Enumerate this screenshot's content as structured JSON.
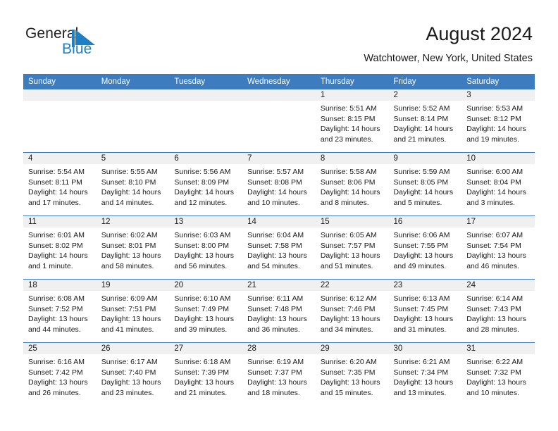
{
  "brand": {
    "name_part1": "General",
    "name_part2": "Blue",
    "flag_color": "#1f7fc4"
  },
  "header": {
    "title": "August 2024",
    "subtitle": "Watchtower, New York, United States"
  },
  "theme": {
    "header_bar": "#3d7dbf",
    "daynum_band": "#f0f0f0",
    "text": "#1a1a1a"
  },
  "labels": {
    "sunrise_prefix": "Sunrise:",
    "sunset_prefix": "Sunset:",
    "daylight_prefix": "Daylight:"
  },
  "weekdays": [
    "Sunday",
    "Monday",
    "Tuesday",
    "Wednesday",
    "Thursday",
    "Friday",
    "Saturday"
  ],
  "weeks": [
    [
      {
        "day": "",
        "empty": true
      },
      {
        "day": "",
        "empty": true
      },
      {
        "day": "",
        "empty": true
      },
      {
        "day": "",
        "empty": true
      },
      {
        "day": "1",
        "sunrise": "Sunrise: 5:51 AM",
        "sunset": "Sunset: 8:15 PM",
        "daylight_line1": "Daylight: 14 hours",
        "daylight_line2": "and 23 minutes."
      },
      {
        "day": "2",
        "sunrise": "Sunrise: 5:52 AM",
        "sunset": "Sunset: 8:14 PM",
        "daylight_line1": "Daylight: 14 hours",
        "daylight_line2": "and 21 minutes."
      },
      {
        "day": "3",
        "sunrise": "Sunrise: 5:53 AM",
        "sunset": "Sunset: 8:12 PM",
        "daylight_line1": "Daylight: 14 hours",
        "daylight_line2": "and 19 minutes."
      }
    ],
    [
      {
        "day": "4",
        "sunrise": "Sunrise: 5:54 AM",
        "sunset": "Sunset: 8:11 PM",
        "daylight_line1": "Daylight: 14 hours",
        "daylight_line2": "and 17 minutes."
      },
      {
        "day": "5",
        "sunrise": "Sunrise: 5:55 AM",
        "sunset": "Sunset: 8:10 PM",
        "daylight_line1": "Daylight: 14 hours",
        "daylight_line2": "and 14 minutes."
      },
      {
        "day": "6",
        "sunrise": "Sunrise: 5:56 AM",
        "sunset": "Sunset: 8:09 PM",
        "daylight_line1": "Daylight: 14 hours",
        "daylight_line2": "and 12 minutes."
      },
      {
        "day": "7",
        "sunrise": "Sunrise: 5:57 AM",
        "sunset": "Sunset: 8:08 PM",
        "daylight_line1": "Daylight: 14 hours",
        "daylight_line2": "and 10 minutes."
      },
      {
        "day": "8",
        "sunrise": "Sunrise: 5:58 AM",
        "sunset": "Sunset: 8:06 PM",
        "daylight_line1": "Daylight: 14 hours",
        "daylight_line2": "and 8 minutes."
      },
      {
        "day": "9",
        "sunrise": "Sunrise: 5:59 AM",
        "sunset": "Sunset: 8:05 PM",
        "daylight_line1": "Daylight: 14 hours",
        "daylight_line2": "and 5 minutes."
      },
      {
        "day": "10",
        "sunrise": "Sunrise: 6:00 AM",
        "sunset": "Sunset: 8:04 PM",
        "daylight_line1": "Daylight: 14 hours",
        "daylight_line2": "and 3 minutes."
      }
    ],
    [
      {
        "day": "11",
        "sunrise": "Sunrise: 6:01 AM",
        "sunset": "Sunset: 8:02 PM",
        "daylight_line1": "Daylight: 14 hours",
        "daylight_line2": "and 1 minute."
      },
      {
        "day": "12",
        "sunrise": "Sunrise: 6:02 AM",
        "sunset": "Sunset: 8:01 PM",
        "daylight_line1": "Daylight: 13 hours",
        "daylight_line2": "and 58 minutes."
      },
      {
        "day": "13",
        "sunrise": "Sunrise: 6:03 AM",
        "sunset": "Sunset: 8:00 PM",
        "daylight_line1": "Daylight: 13 hours",
        "daylight_line2": "and 56 minutes."
      },
      {
        "day": "14",
        "sunrise": "Sunrise: 6:04 AM",
        "sunset": "Sunset: 7:58 PM",
        "daylight_line1": "Daylight: 13 hours",
        "daylight_line2": "and 54 minutes."
      },
      {
        "day": "15",
        "sunrise": "Sunrise: 6:05 AM",
        "sunset": "Sunset: 7:57 PM",
        "daylight_line1": "Daylight: 13 hours",
        "daylight_line2": "and 51 minutes."
      },
      {
        "day": "16",
        "sunrise": "Sunrise: 6:06 AM",
        "sunset": "Sunset: 7:55 PM",
        "daylight_line1": "Daylight: 13 hours",
        "daylight_line2": "and 49 minutes."
      },
      {
        "day": "17",
        "sunrise": "Sunrise: 6:07 AM",
        "sunset": "Sunset: 7:54 PM",
        "daylight_line1": "Daylight: 13 hours",
        "daylight_line2": "and 46 minutes."
      }
    ],
    [
      {
        "day": "18",
        "sunrise": "Sunrise: 6:08 AM",
        "sunset": "Sunset: 7:52 PM",
        "daylight_line1": "Daylight: 13 hours",
        "daylight_line2": "and 44 minutes."
      },
      {
        "day": "19",
        "sunrise": "Sunrise: 6:09 AM",
        "sunset": "Sunset: 7:51 PM",
        "daylight_line1": "Daylight: 13 hours",
        "daylight_line2": "and 41 minutes."
      },
      {
        "day": "20",
        "sunrise": "Sunrise: 6:10 AM",
        "sunset": "Sunset: 7:49 PM",
        "daylight_line1": "Daylight: 13 hours",
        "daylight_line2": "and 39 minutes."
      },
      {
        "day": "21",
        "sunrise": "Sunrise: 6:11 AM",
        "sunset": "Sunset: 7:48 PM",
        "daylight_line1": "Daylight: 13 hours",
        "daylight_line2": "and 36 minutes."
      },
      {
        "day": "22",
        "sunrise": "Sunrise: 6:12 AM",
        "sunset": "Sunset: 7:46 PM",
        "daylight_line1": "Daylight: 13 hours",
        "daylight_line2": "and 34 minutes."
      },
      {
        "day": "23",
        "sunrise": "Sunrise: 6:13 AM",
        "sunset": "Sunset: 7:45 PM",
        "daylight_line1": "Daylight: 13 hours",
        "daylight_line2": "and 31 minutes."
      },
      {
        "day": "24",
        "sunrise": "Sunrise: 6:14 AM",
        "sunset": "Sunset: 7:43 PM",
        "daylight_line1": "Daylight: 13 hours",
        "daylight_line2": "and 28 minutes."
      }
    ],
    [
      {
        "day": "25",
        "sunrise": "Sunrise: 6:16 AM",
        "sunset": "Sunset: 7:42 PM",
        "daylight_line1": "Daylight: 13 hours",
        "daylight_line2": "and 26 minutes."
      },
      {
        "day": "26",
        "sunrise": "Sunrise: 6:17 AM",
        "sunset": "Sunset: 7:40 PM",
        "daylight_line1": "Daylight: 13 hours",
        "daylight_line2": "and 23 minutes."
      },
      {
        "day": "27",
        "sunrise": "Sunrise: 6:18 AM",
        "sunset": "Sunset: 7:39 PM",
        "daylight_line1": "Daylight: 13 hours",
        "daylight_line2": "and 21 minutes."
      },
      {
        "day": "28",
        "sunrise": "Sunrise: 6:19 AM",
        "sunset": "Sunset: 7:37 PM",
        "daylight_line1": "Daylight: 13 hours",
        "daylight_line2": "and 18 minutes."
      },
      {
        "day": "29",
        "sunrise": "Sunrise: 6:20 AM",
        "sunset": "Sunset: 7:35 PM",
        "daylight_line1": "Daylight: 13 hours",
        "daylight_line2": "and 15 minutes."
      },
      {
        "day": "30",
        "sunrise": "Sunrise: 6:21 AM",
        "sunset": "Sunset: 7:34 PM",
        "daylight_line1": "Daylight: 13 hours",
        "daylight_line2": "and 13 minutes."
      },
      {
        "day": "31",
        "sunrise": "Sunrise: 6:22 AM",
        "sunset": "Sunset: 7:32 PM",
        "daylight_line1": "Daylight: 13 hours",
        "daylight_line2": "and 10 minutes."
      }
    ]
  ]
}
